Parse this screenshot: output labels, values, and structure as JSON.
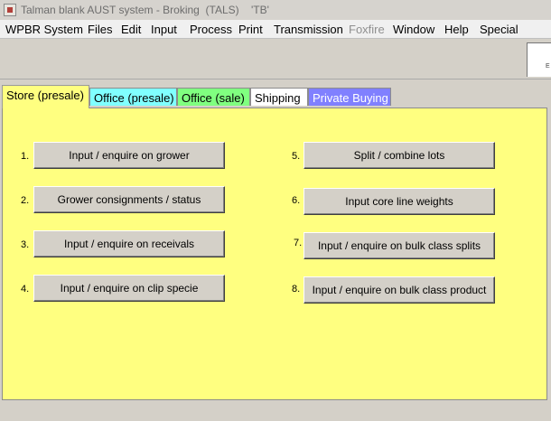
{
  "window": {
    "title": "Talman blank AUST system - Broking  (TALS)    'TB'"
  },
  "menu": [
    {
      "label": "WPBR System",
      "disabled": false
    },
    {
      "label": "Files",
      "disabled": false
    },
    {
      "label": "Edit",
      "disabled": false
    },
    {
      "label": "Input",
      "disabled": false
    },
    {
      "label": "Process",
      "disabled": false
    },
    {
      "label": "Print",
      "disabled": false
    },
    {
      "label": "Transmission",
      "disabled": false
    },
    {
      "label": "Foxfire",
      "disabled": true
    },
    {
      "label": "Window",
      "disabled": false
    },
    {
      "label": "Help",
      "disabled": false
    },
    {
      "label": "Special",
      "disabled": false
    }
  ],
  "toolbar": {
    "panel_text": "E"
  },
  "tabs": [
    {
      "label": "Store (presale)",
      "bg": "#ffff80",
      "fg": "#000000",
      "active": true
    },
    {
      "label": "Office (presale)",
      "bg": "#80ffff",
      "fg": "#000000",
      "active": false
    },
    {
      "label": "Office (sale)",
      "bg": "#80ff80",
      "fg": "#000000",
      "active": false
    },
    {
      "label": "Shipping",
      "bg": "#ffffff",
      "fg": "#000000",
      "active": false
    },
    {
      "label": "Private Buying",
      "bg": "#8080ff",
      "fg": "#ffffff",
      "active": false
    }
  ],
  "left_buttons": [
    {
      "num": "1.",
      "label": "Input / enquire on grower"
    },
    {
      "num": "2.",
      "label": "Grower consignments / status"
    },
    {
      "num": "3.",
      "label": "Input / enquire on receivals"
    },
    {
      "num": "4.",
      "label": "Input / enquire on  clip specie"
    }
  ],
  "right_buttons": [
    {
      "num": "5.",
      "label": "Split / combine lots"
    },
    {
      "num": "6.",
      "label": "Input core line weights"
    },
    {
      "num": "7.",
      "label": "Input / enquire on bulk class splits"
    },
    {
      "num": "8.",
      "label": "Input / enquire on bulk class product"
    }
  ],
  "colors": {
    "panel_bg": "#ffff80",
    "chrome": "#d4d0c8",
    "menubar": "#f0f0f0"
  }
}
